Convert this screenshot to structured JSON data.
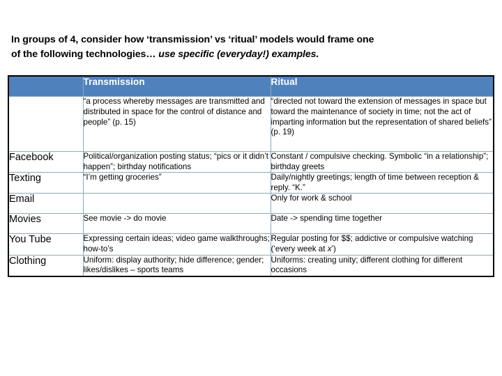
{
  "slide": {
    "prompt_line1_pre": "In groups of 4, consider how ‘transmission’ vs ‘ritual’ models would frame one",
    "prompt_line2_pre": "of the following technologies… ",
    "prompt_line2_italic": "use specific (everyday!) examples."
  },
  "table": {
    "headers": {
      "corner": "",
      "transmission": "Transmission",
      "ritual": "Ritual"
    },
    "definition_row": {
      "label": "",
      "transmission": "“a process whereby messages are transmitted and distributed in space for the control of distance and people” (p. 15)",
      "ritual": "“directed not toward the extension of messages in space but toward the maintenance of society in time; not the act of imparting information but the representation of shared beliefs” (p. 19)"
    },
    "rows": [
      {
        "label": "Facebook",
        "transmission": "Political/organization posting status; “pics or it didn’t happen”; birthday notifications",
        "ritual": "Constant / compulsive checking. Symbolic “in a relationship”; birthday greets"
      },
      {
        "label": "Texting",
        "transmission": "“I’m getting groceries”",
        "ritual": "Daily/nightly greetings; length of time between reception & reply. “K.”"
      },
      {
        "label": "Email",
        "transmission": "",
        "ritual": "Only for work & school"
      },
      {
        "label": "Movies",
        "transmission": "See movie -> do movie",
        "ritual": "Date -> spending time together"
      },
      {
        "label": "You Tube",
        "transmission": "Expressing certain ideas; video game walkthroughs; how-to’s",
        "ritual_pre": "Regular posting for $$; addictive or compulsive watching (‘every week at ",
        "ritual_italic": "x",
        "ritual_post": "’)"
      },
      {
        "label": "Clothing",
        "transmission": "Uniform: display authority; hide difference; gender; likes/dislikes – sports teams",
        "ritual": "Uniforms: creating unity; different clothing for different occasions"
      }
    ]
  },
  "colors": {
    "header_blue": "#4F81BD",
    "grid_line": "#8FA9B8",
    "outer_border": "#000000",
    "text": "#000000"
  }
}
